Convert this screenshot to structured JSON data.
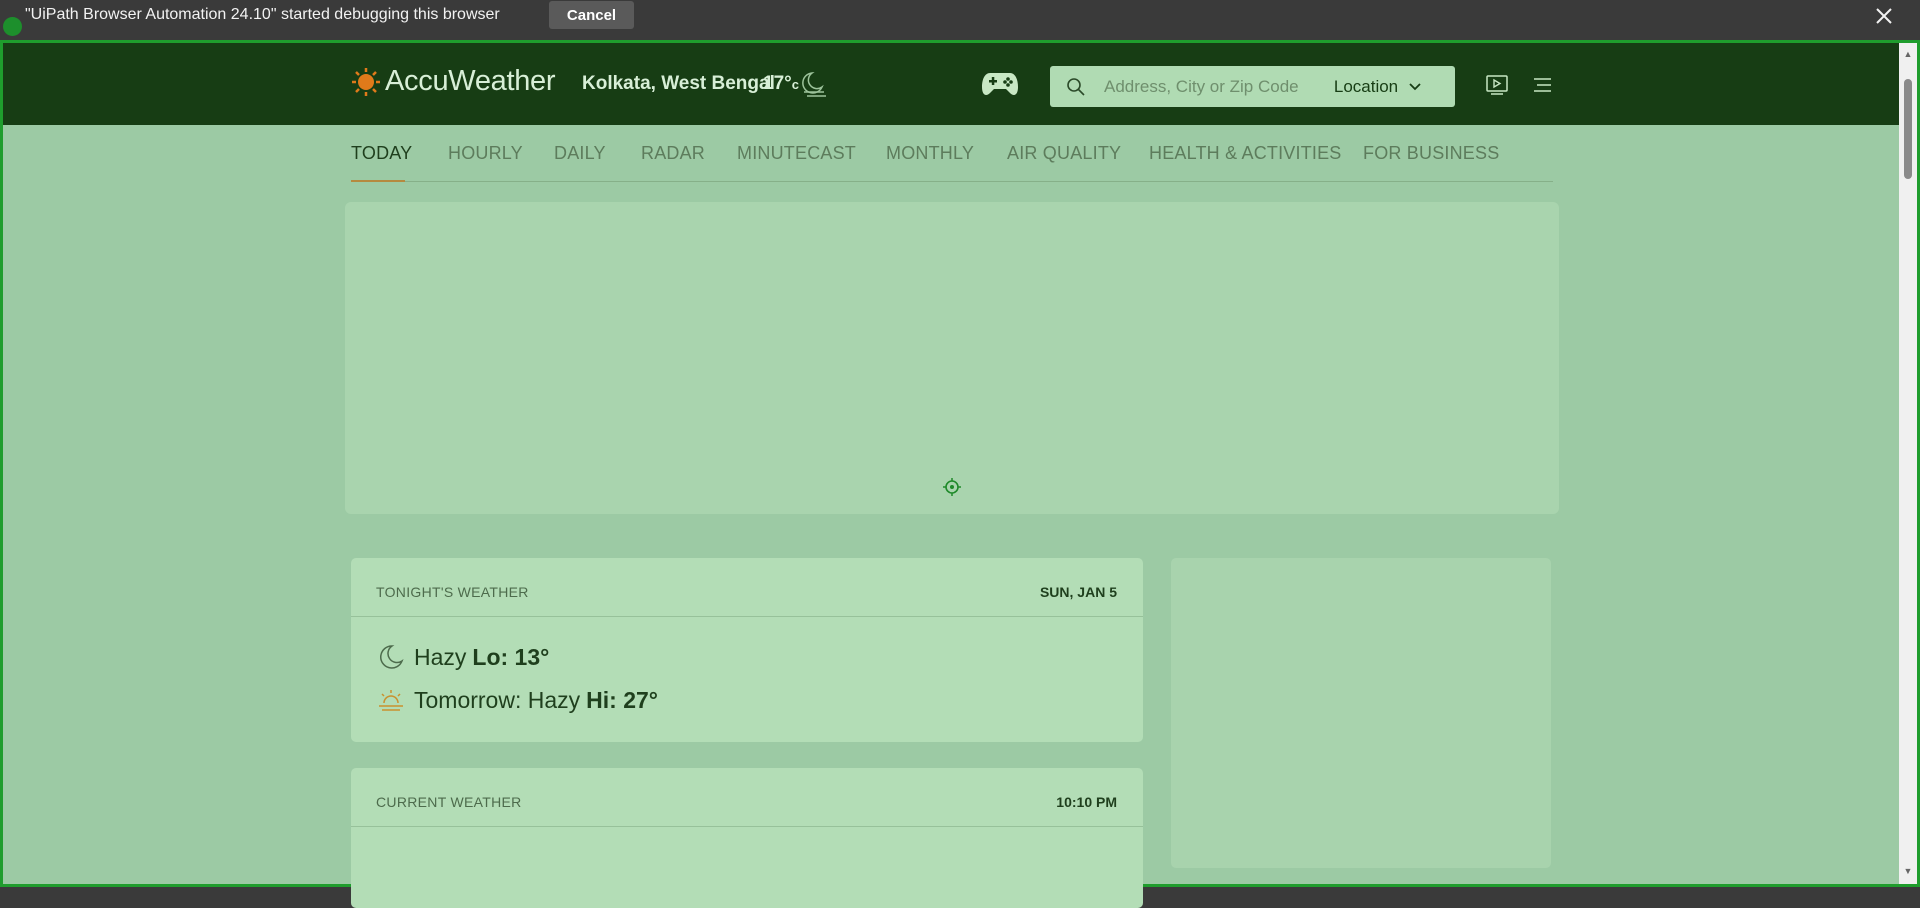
{
  "debug_bar": {
    "message": "\"UiPath Browser Automation 24.10\" started debugging this browser",
    "cancel_label": "Cancel"
  },
  "header": {
    "brand": "AccuWeather",
    "location": "Kolkata, West Bengal",
    "temperature": "17°",
    "temperature_unit": "c",
    "search_placeholder": "Address, City or Zip Code",
    "location_button": "Location"
  },
  "nav": {
    "items": [
      "TODAY",
      "HOURLY",
      "DAILY",
      "RADAR",
      "MINUTECAST",
      "MONTHLY",
      "AIR QUALITY",
      "HEALTH & ACTIVITIES",
      "FOR BUSINESS"
    ],
    "active": "TODAY"
  },
  "tonight_card": {
    "title": "TONIGHT'S WEATHER",
    "date": "SUN, JAN 5",
    "tonight_condition": "Hazy",
    "tonight_lo": "Lo: 13°",
    "tomorrow_condition": "Tomorrow: Hazy",
    "tomorrow_hi": "Hi: 27°"
  },
  "current_card": {
    "title": "CURRENT WEATHER",
    "time": "10:10 PM"
  },
  "colors": {
    "header_bg": "#173d14",
    "page_bg": "#9ccaa4",
    "accent": "#b58a3f",
    "frame_border": "#1f9d2d"
  }
}
